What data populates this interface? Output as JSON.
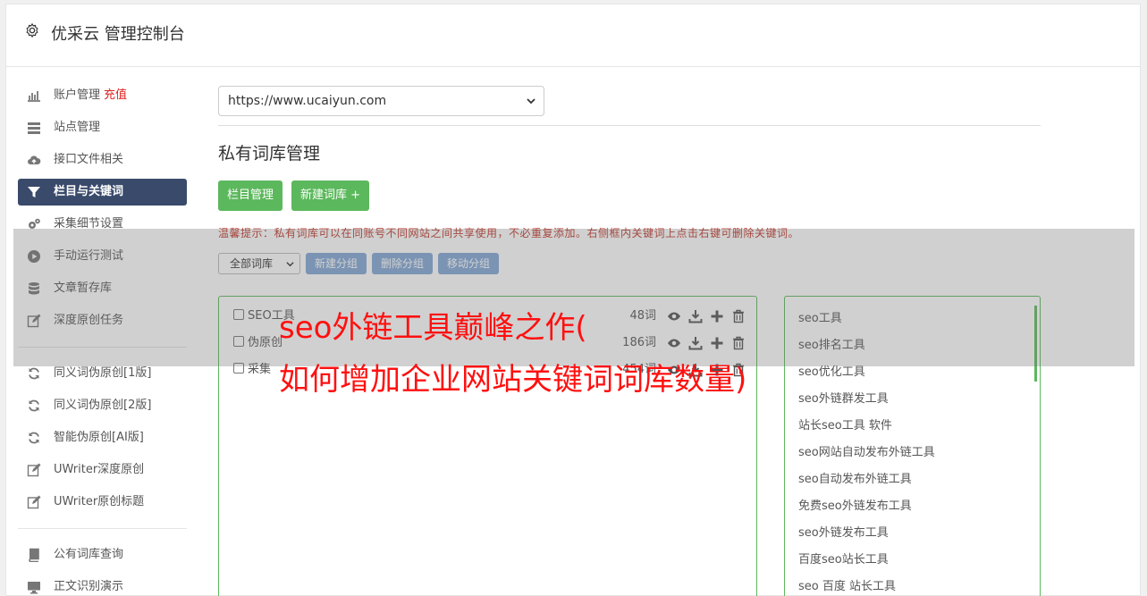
{
  "header": {
    "title": "优采云 管理控制台"
  },
  "sidebar": {
    "items": [
      {
        "label": "账户管理",
        "badge": "充值",
        "icon": "bar-chart-icon"
      },
      {
        "label": "站点管理",
        "icon": "server-icon"
      },
      {
        "label": "接口文件相关",
        "icon": "cloud-upload-icon"
      },
      {
        "label": "栏目与关键词",
        "icon": "filter-icon",
        "active": true
      },
      {
        "label": "采集细节设置",
        "icon": "gears-icon"
      },
      {
        "label": "手动运行测试",
        "icon": "play-circle-icon"
      },
      {
        "label": "文章暂存库",
        "icon": "database-icon"
      },
      {
        "label": "深度原创任务",
        "icon": "edit-icon"
      },
      {
        "label": "同义词伪原创[1版]",
        "icon": "refresh-icon"
      },
      {
        "label": "同义词伪原创[2版]",
        "icon": "refresh-icon"
      },
      {
        "label": "智能伪原创[AI版]",
        "icon": "refresh-icon"
      },
      {
        "label": "UWriter深度原创",
        "icon": "edit-icon"
      },
      {
        "label": "UWriter原创标题",
        "icon": "edit-icon"
      },
      {
        "label": "公有词库查询",
        "icon": "book-icon"
      },
      {
        "label": "正文识别演示",
        "icon": "monitor-icon"
      }
    ]
  },
  "main": {
    "site_select": "https://www.ucaiyun.com",
    "section_title": "私有词库管理",
    "buttons": {
      "column_manage": "栏目管理",
      "new_dict": "新建词库 +"
    },
    "tip": "温馨提示：私有词库可以在同账号不同网站之间共享使用，不必重复添加。右侧框内关键词上点击右键可删除关键词。",
    "dict_filter": "全部词库",
    "group_buttons": {
      "new_group": "新建分组",
      "delete_group": "删除分组",
      "move_group": "移动分组"
    },
    "dicts": [
      {
        "name": "SEO工具",
        "count": "48词"
      },
      {
        "name": "伪原创",
        "count": "186词"
      },
      {
        "name": "采集",
        "count": "454词"
      }
    ],
    "keywords": [
      "seo工具",
      "seo排名工具",
      "seo优化工具",
      "seo外链群发工具",
      "站长seo工具 软件",
      "seo网站自动发布外链工具",
      "seo自动发布外链工具",
      "免费seo外链发布工具",
      "seo外链发布工具",
      "百度seo站长工具",
      "seo 百度 站长工具"
    ]
  },
  "overlay": {
    "line1": "seo外链工具巅峰之作(",
    "line2": "如何增加企业网站关键词词库数量)"
  },
  "colors": {
    "accent_green": "#5cb85c",
    "nav_active": "#394a6b",
    "headline_red": "#ff1010",
    "group_blue": "#82a7d6"
  }
}
